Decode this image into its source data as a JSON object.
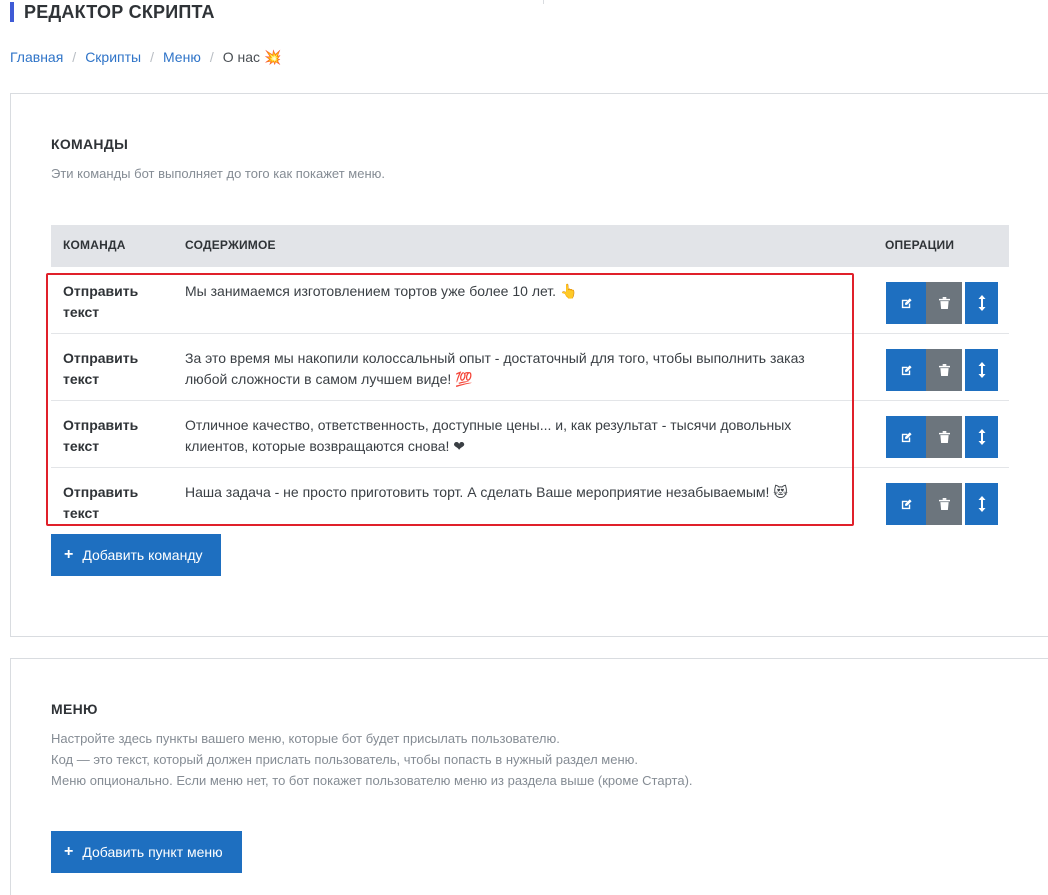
{
  "page_title": "РЕДАКТОР СКРИПТА",
  "breadcrumb": {
    "items": [
      "Главная",
      "Скрипты",
      "Меню"
    ],
    "current": "О нас",
    "current_icon": "💥",
    "separator": "/"
  },
  "commands": {
    "title": "КОМАНДЫ",
    "description": "Эти команды бот выполняет до того как покажет меню.",
    "columns": {
      "command": "КОМАНДА",
      "content": "СОДЕРЖИМОЕ",
      "operations": "ОПЕРАЦИИ"
    },
    "rows": [
      {
        "command": "Отправить текст",
        "content": "Мы занимаемся изготовлением тортов уже более 10 лет. 👆"
      },
      {
        "command": "Отправить текст",
        "content": "За это время мы накопили колоссальный опыт - достаточный для того, чтобы выполнить заказ любой сложности в самом лучшем виде! 💯"
      },
      {
        "command": "Отправить текст",
        "content": "Отличное качество, ответственность, доступные цены... и, как результат - тысячи довольных клиентов, которые возвращаются снова! ❤"
      },
      {
        "command": "Отправить текст",
        "content": "Наша задача - не просто приготовить торт. А сделать Ваше мероприятие незабываемым! 😻"
      }
    ],
    "add_label": "Добавить команду"
  },
  "menu": {
    "title": "МЕНЮ",
    "description": [
      "Настройте здесь пункты вашего меню, которые бот будет присылать пользователю.",
      "Код — это текст, который должен прислать пользователь, чтобы попасть в нужный раздел меню.",
      "Меню опционально. Если меню нет, то бот покажет пользователю меню из раздела выше (кроме Старта)."
    ],
    "add_label": "Добавить пункт меню"
  },
  "icons": {
    "edit": "edit-icon",
    "delete": "trash-icon",
    "move": "move-vertical-icon",
    "plus": "plus-icon"
  },
  "colors": {
    "accent": "#1e6fc0",
    "title_bar": "#3f5bd6",
    "highlight": "#e0202a",
    "delete_btn": "#6c757d"
  }
}
